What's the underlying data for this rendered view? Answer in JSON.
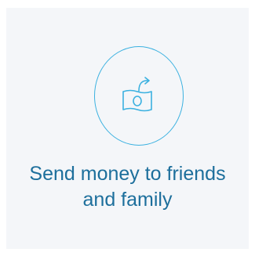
{
  "promo": {
    "icon": "money-bill-send-icon",
    "headline_line1": "Send money to friends",
    "headline_line2": "and family"
  },
  "colors": {
    "accent": "#3bb1e0",
    "headline": "#1d6f9c",
    "card_background": "#f4f6f9"
  }
}
